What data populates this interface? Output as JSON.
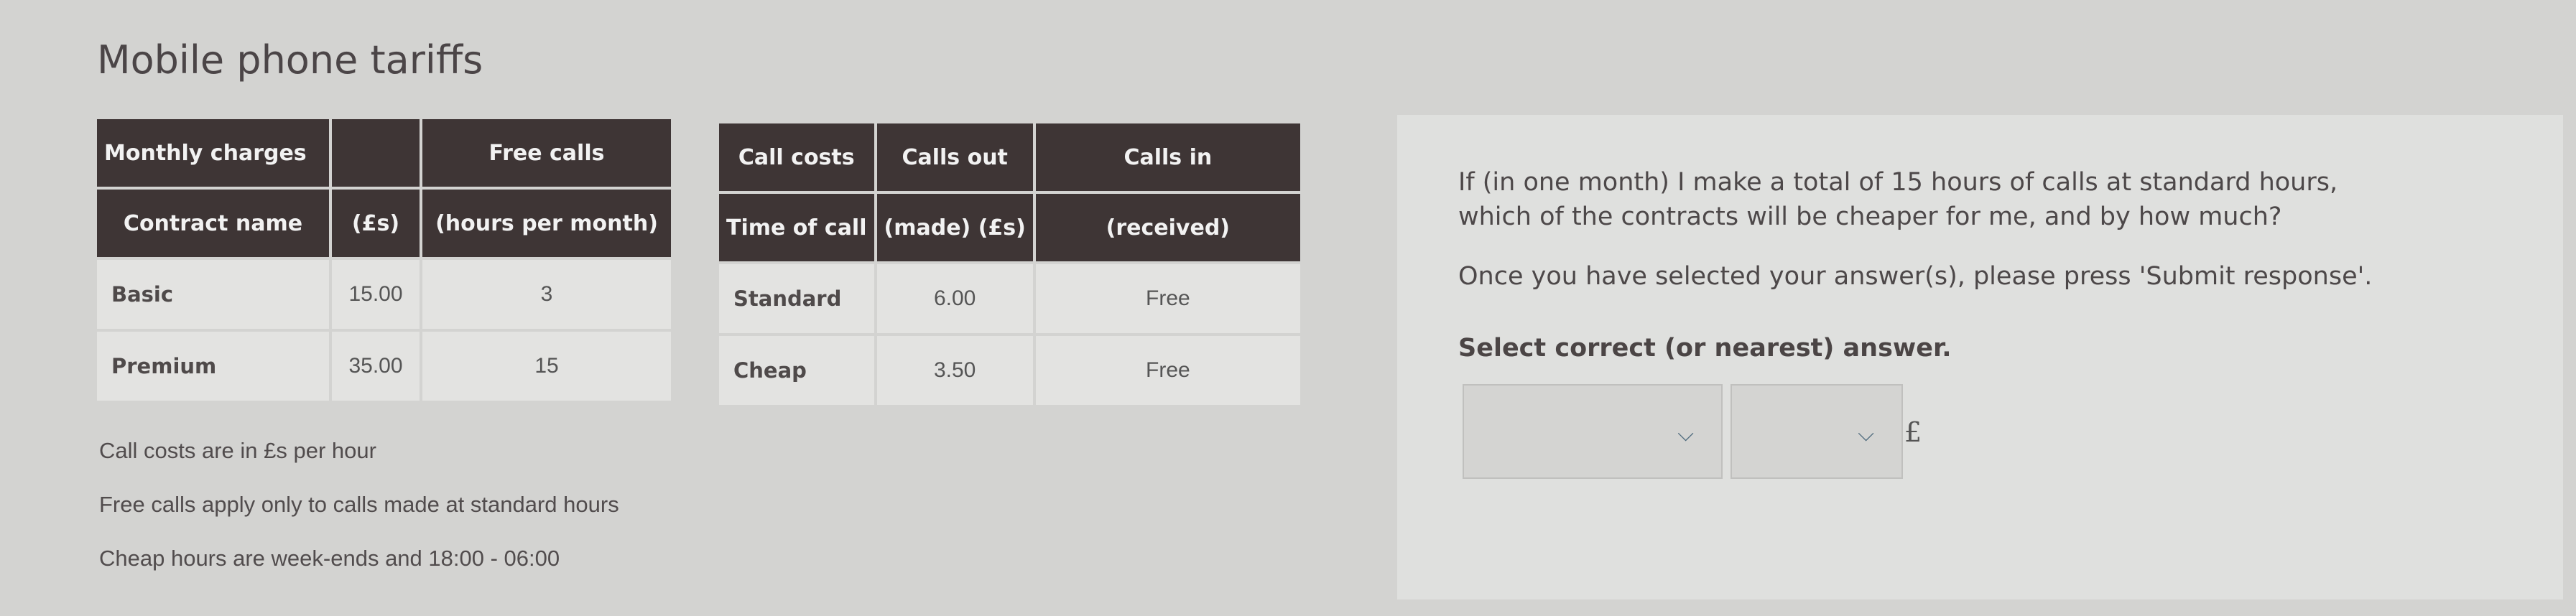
{
  "page": {
    "title": "Mobile phone tariffs"
  },
  "monthly_table": {
    "header_row1": [
      "Monthly charges",
      "",
      "Free calls"
    ],
    "header_row2": [
      "Contract name",
      "(£s)",
      "(hours per month)"
    ],
    "rows": [
      [
        "Basic",
        "15.00",
        "3"
      ],
      [
        "Premium",
        "35.00",
        "15"
      ]
    ]
  },
  "call_costs_table": {
    "header_row1": [
      "Call costs",
      "Calls out",
      "Calls in"
    ],
    "header_row2": [
      "Time of call",
      "(made) (£s)",
      "(received)"
    ],
    "rows": [
      [
        "Standard",
        "6.00",
        "Free"
      ],
      [
        "Cheap",
        "3.50",
        "Free"
      ]
    ]
  },
  "notes": [
    "Call costs are in £s per hour",
    "Free calls apply only to calls made at standard hours",
    "Cheap hours are week-ends and 18:00 - 06:00"
  ],
  "question": {
    "line1": "If (in one month) I make a total of 15 hours of calls at standard hours,",
    "line2": "which of the contracts will be cheaper for me, and by how much?",
    "instruction": "Once you have selected your answer(s), please press 'Submit response'.",
    "select_label": "Select correct (or nearest) answer.",
    "dropdown_contract": {
      "value": "",
      "icon": "chevron-down-icon"
    },
    "dropdown_amount": {
      "value": "",
      "icon": "chevron-down-icon"
    },
    "currency_suffix": "£"
  },
  "colors": {
    "header_bg": "#3e3535",
    "cell_bg": "#e3e3e1",
    "chevron": "#4f6b7d"
  }
}
